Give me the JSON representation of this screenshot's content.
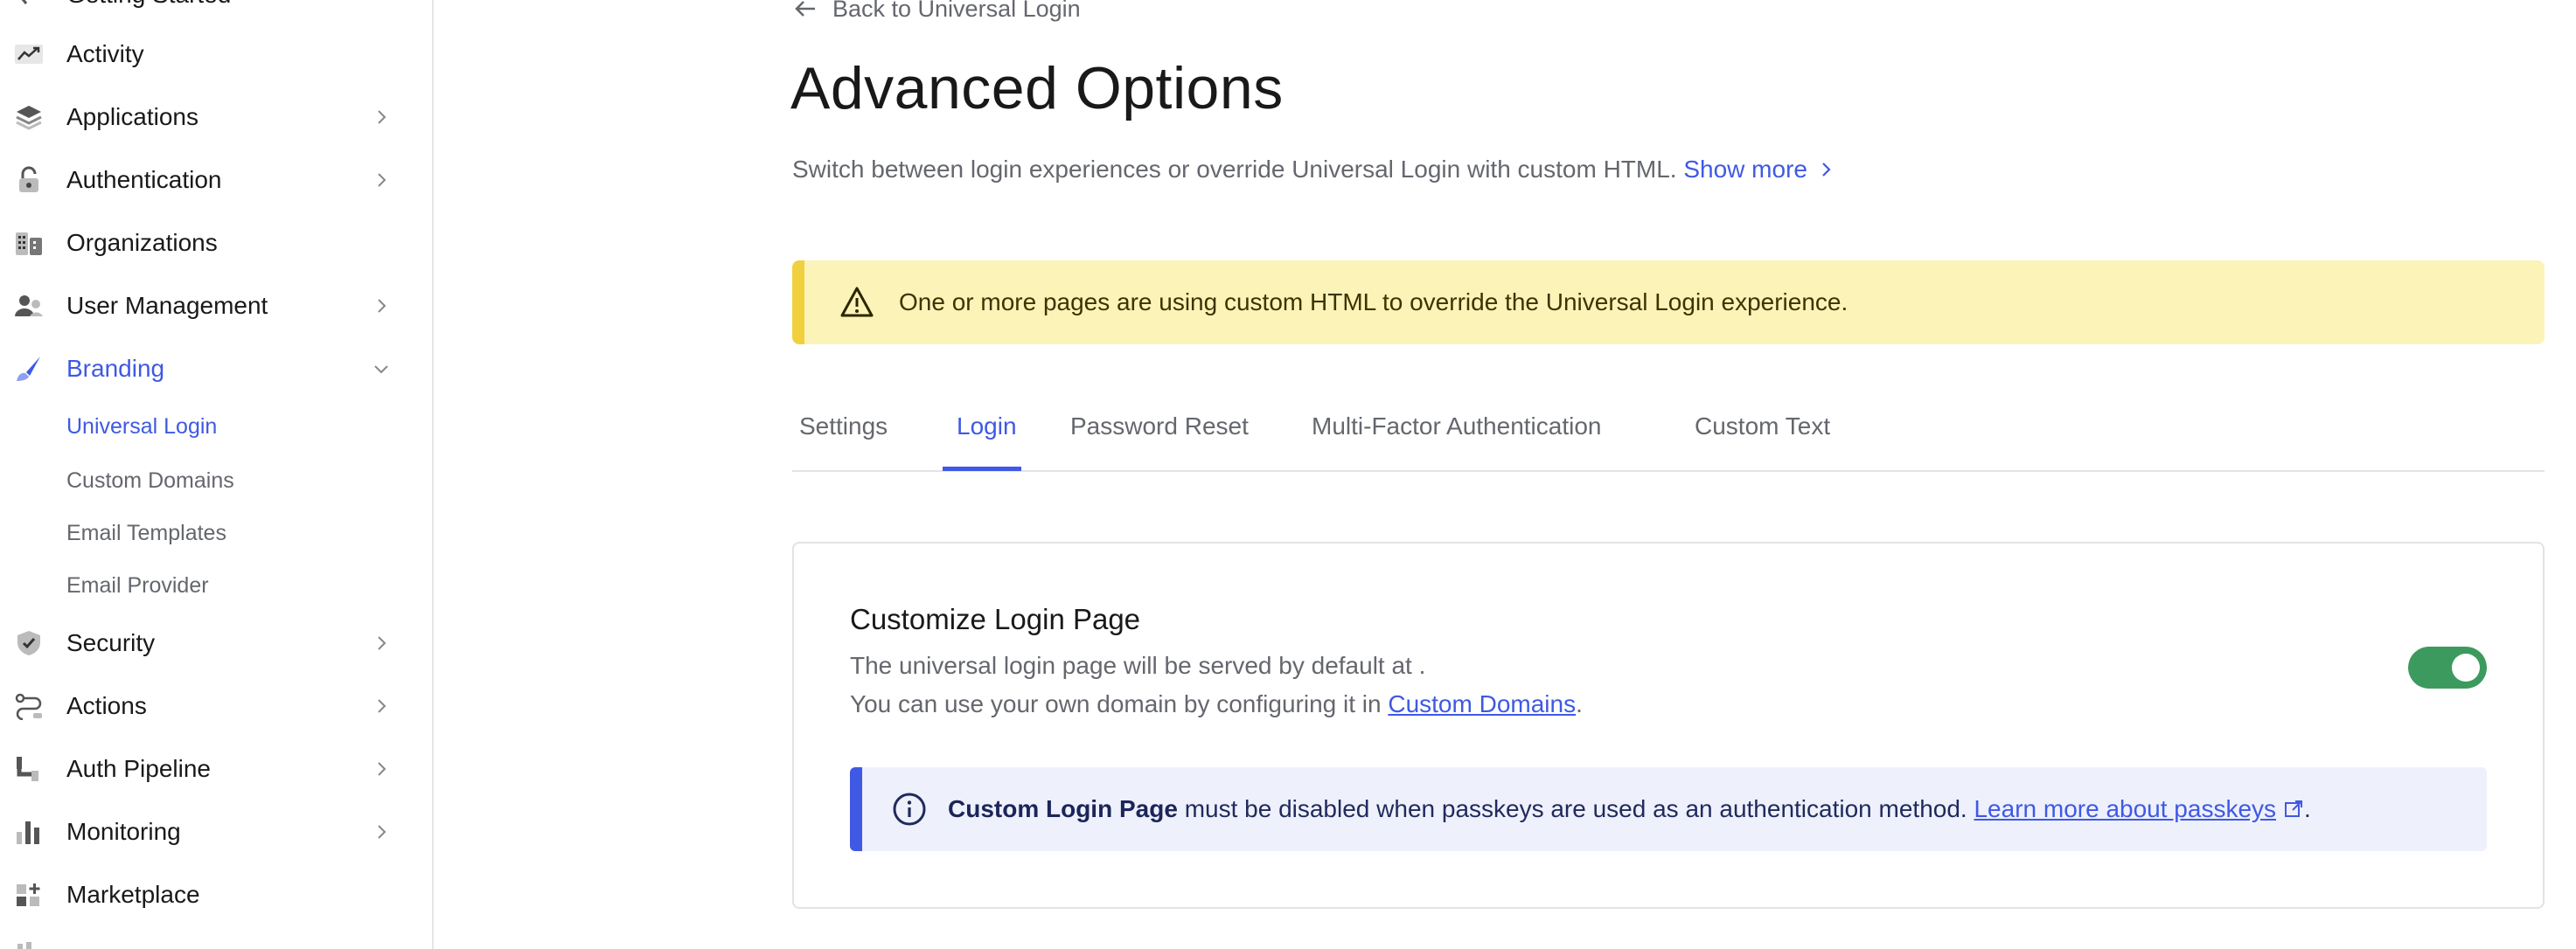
{
  "sidebar": {
    "cut_label": "Getting Started",
    "items": [
      {
        "label": "Activity",
        "icon": "activity-icon"
      },
      {
        "label": "Applications",
        "icon": "applications-icon",
        "chevron": "chevron-right-icon"
      },
      {
        "label": "Authentication",
        "icon": "lock-icon",
        "chevron": "chevron-right-icon"
      },
      {
        "label": "Organizations",
        "icon": "building-icon"
      },
      {
        "label": "User Management",
        "icon": "users-icon",
        "chevron": "chevron-right-icon"
      },
      {
        "label": "Branding",
        "icon": "brush-icon",
        "chevron": "chevron-down-icon",
        "active": true
      },
      {
        "label": "Security",
        "icon": "shield-icon",
        "chevron": "chevron-right-icon"
      },
      {
        "label": "Actions",
        "icon": "actions-icon",
        "chevron": "chevron-right-icon"
      },
      {
        "label": "Auth Pipeline",
        "icon": "pipeline-icon",
        "chevron": "chevron-right-icon"
      },
      {
        "label": "Monitoring",
        "icon": "chart-icon",
        "chevron": "chevron-right-icon"
      },
      {
        "label": "Marketplace",
        "icon": "marketplace-icon"
      }
    ],
    "branding_sub": [
      {
        "label": "Universal Login",
        "active": true
      },
      {
        "label": "Custom Domains"
      },
      {
        "label": "Email Templates"
      },
      {
        "label": "Email Provider"
      }
    ]
  },
  "main": {
    "back_label": "Back to Universal Login",
    "title": "Advanced Options",
    "description": "Switch between login experiences or override Universal Login with custom HTML.",
    "show_more": "Show more",
    "warning": "One or more pages are using custom HTML to override the Universal Login experience.",
    "tabs": [
      {
        "label": "Settings"
      },
      {
        "label": "Login",
        "active": true
      },
      {
        "label": "Password Reset"
      },
      {
        "label": "Multi-Factor Authentication"
      },
      {
        "label": "Custom Text"
      }
    ],
    "card": {
      "title": "Customize Login Page",
      "line1": "The universal login page will be served by default at .",
      "line2_prefix": "You can use your own domain by configuring it in",
      "line2_link": "Custom Domains",
      "line2_suffix": ".",
      "toggle_on": true,
      "info_bold": "Custom Login Page",
      "info_text": "must be disabled when passkeys are used as an authentication method.",
      "info_link": "Learn more about passkeys",
      "info_suffix": "."
    }
  },
  "colors": {
    "accent": "#3f59e4",
    "warning_bg": "#fcf3b8",
    "warning_border": "#f0d03f",
    "toggle_on": "#3d9a5e",
    "info_bg": "#eef0fb"
  }
}
